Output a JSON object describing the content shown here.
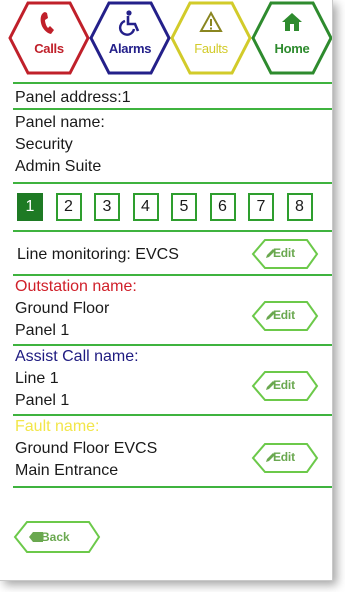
{
  "nav": [
    {
      "name": "calls-button",
      "label": "Calls",
      "color": "#c0202a",
      "icon": "phone-icon"
    },
    {
      "name": "alarms-button",
      "label": "Alarms",
      "color": "#24208a",
      "icon": "wheelchair-icon"
    },
    {
      "name": "faults-button",
      "label": "Faults",
      "color": "#d2cb2a",
      "icon": "warning-icon"
    },
    {
      "name": "home-button",
      "label": "Home",
      "color": "#2e8b2e",
      "icon": "home-icon"
    }
  ],
  "panel": {
    "address_label": "Panel address:",
    "address_value": "1",
    "name_label": "Panel name:",
    "name_line1": "Security",
    "name_line2": "Admin Suite"
  },
  "tabs": [
    "1",
    "2",
    "3",
    "4",
    "5",
    "6",
    "7",
    "8"
  ],
  "active_tab": 0,
  "line_monitoring": {
    "label": "Line monitoring:",
    "value": "EVCS"
  },
  "outstation": {
    "label": "Outstation name:",
    "line1": "Ground Floor",
    "line2": "Panel 1",
    "color": "#d0202a"
  },
  "assist_call": {
    "label": "Assist Call name:",
    "line1": "Line 1",
    "line2": "Panel 1",
    "color": "#1e1a80"
  },
  "fault": {
    "label": "Fault name:",
    "line1": "Ground Floor EVCS",
    "line2": "Main Entrance",
    "color": "#f2e64a"
  },
  "edit_label": "Edit",
  "back_label": "Back",
  "colors": {
    "accent": "#3fb33f",
    "active_tab": "#1e7a24",
    "button_text": "#6aa84f"
  }
}
